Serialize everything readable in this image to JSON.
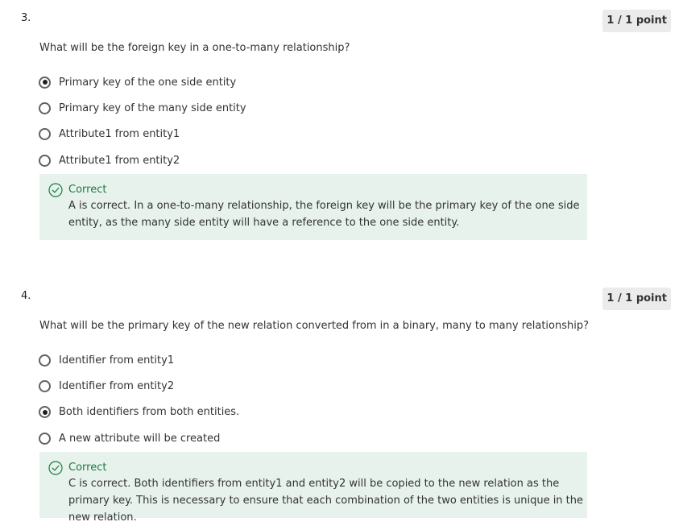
{
  "questions": [
    {
      "number": "3.",
      "points": "1 / 1 point",
      "text": "What will be the foreign key in a one-to-many relationship?",
      "options": [
        {
          "label": "Primary key of the one side entity",
          "selected": true
        },
        {
          "label": "Primary key of the many side entity",
          "selected": false
        },
        {
          "label": "Attribute1 from entity1",
          "selected": false
        },
        {
          "label": "Attribute1 from entity2",
          "selected": false
        }
      ],
      "feedback": {
        "title": "Correct",
        "body": "A is correct. In a one-to-many relationship, the foreign key will be the primary key of the one side entity, as the many side entity will have a reference to the one side entity."
      }
    },
    {
      "number": "4.",
      "points": "1 / 1 point",
      "text": "What will be the primary key of the new relation converted from in a binary, many to many relationship?",
      "options": [
        {
          "label": "Identifier from entity1",
          "selected": false
        },
        {
          "label": "Identifier from entity2",
          "selected": false
        },
        {
          "label": "Both identifiers from both entities.",
          "selected": true
        },
        {
          "label": "A new attribute will be created",
          "selected": false
        }
      ],
      "feedback": {
        "title": "Correct",
        "body": "C is correct. Both identifiers from entity1 and entity2 will be copied to the new relation as the primary key. This is necessary to ensure that each combination of the two entities is unique in the new relation."
      }
    }
  ],
  "colors": {
    "correct_green": "#1a7a43",
    "feedback_bg": "#e7f2ec",
    "points_bg": "#ebebeb"
  },
  "icons": {
    "feedback": "check-circle-icon"
  }
}
